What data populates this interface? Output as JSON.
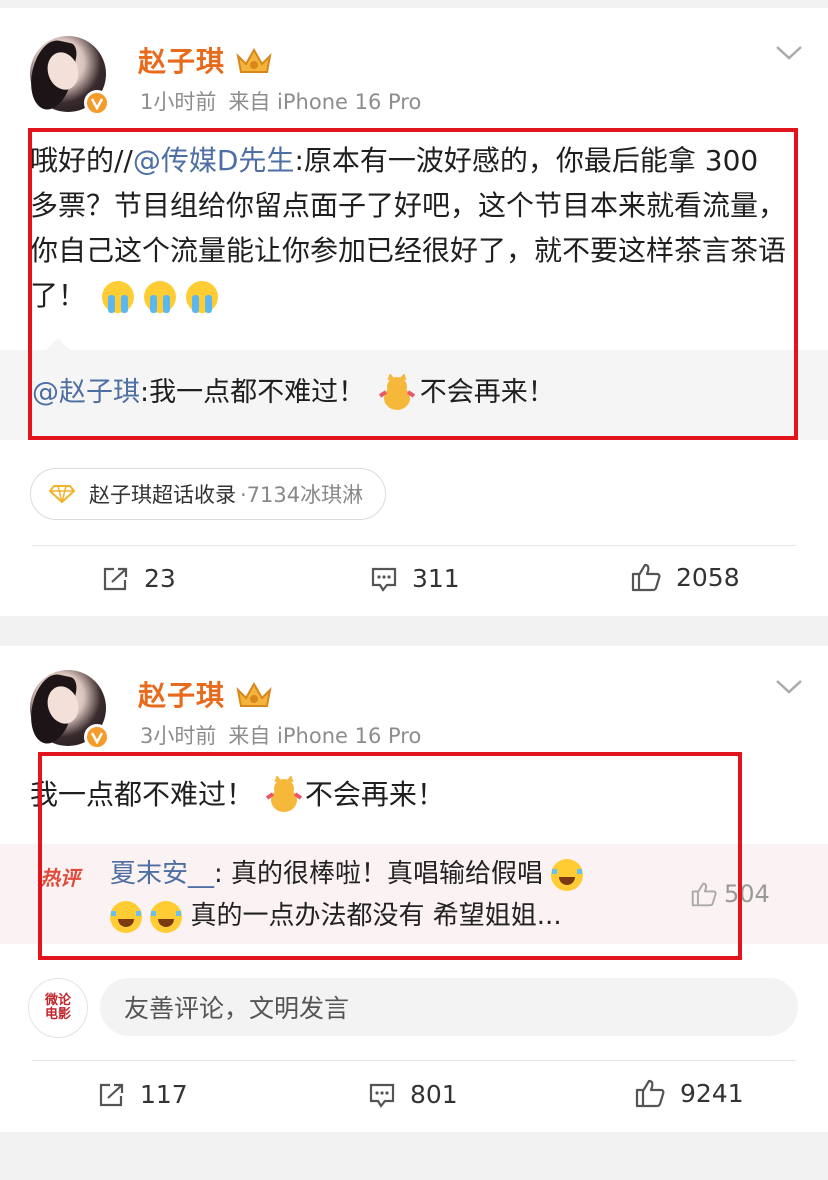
{
  "colors": {
    "username": "#e86a1c",
    "mention": "#4d6fa3",
    "highlight_box": "#e3141b",
    "meta_gray": "#8d8d8d",
    "hot_tag": "#e04b3a"
  },
  "posts": [
    {
      "username": "赵子琪",
      "time": "1小时前",
      "source": "来自 iPhone 16 Pro",
      "text_prefix": "哦好的//",
      "mention": "@传媒D先生",
      "text_body": ":原本有一波好感的，你最后能拿 300 多票？节目组给你留点面子了好吧，这个节目本来就看流量，你自己这个流量能让你参加已经很好了，就不要这样茶言茶语了！",
      "emojis": [
        "cry-icon",
        "cry-icon",
        "cry-icon"
      ],
      "repost": {
        "mention": "@赵子琪",
        "text_a": ":我一点都不难过！",
        "sticker": "dancing-cat-icon",
        "text_b": "不会再来！"
      },
      "topic": {
        "icon": "diamond-icon",
        "label": "赵子琪超话收录",
        "count": "·7134冰琪淋"
      },
      "actions": {
        "reposts": "23",
        "comments": "311",
        "likes": "2058"
      }
    },
    {
      "username": "赵子琪",
      "time": "3小时前",
      "source": "来自 iPhone 16 Pro",
      "text_a": "我一点都不难过！",
      "sticker": "dancing-cat-icon",
      "text_b": "不会再来！",
      "hot_comment": {
        "tag": "热评",
        "commenter": "夏末安__",
        "line1": ": 真的很棒啦！真唱输给假唱",
        "line2": "真的一点办法都没有  希望姐姐...",
        "likes": "504"
      },
      "comment_box": {
        "avatar_text": "微论电影",
        "placeholder": "友善评论，文明发言"
      },
      "actions": {
        "reposts": "117",
        "comments": "801",
        "likes": "9241"
      }
    }
  ]
}
